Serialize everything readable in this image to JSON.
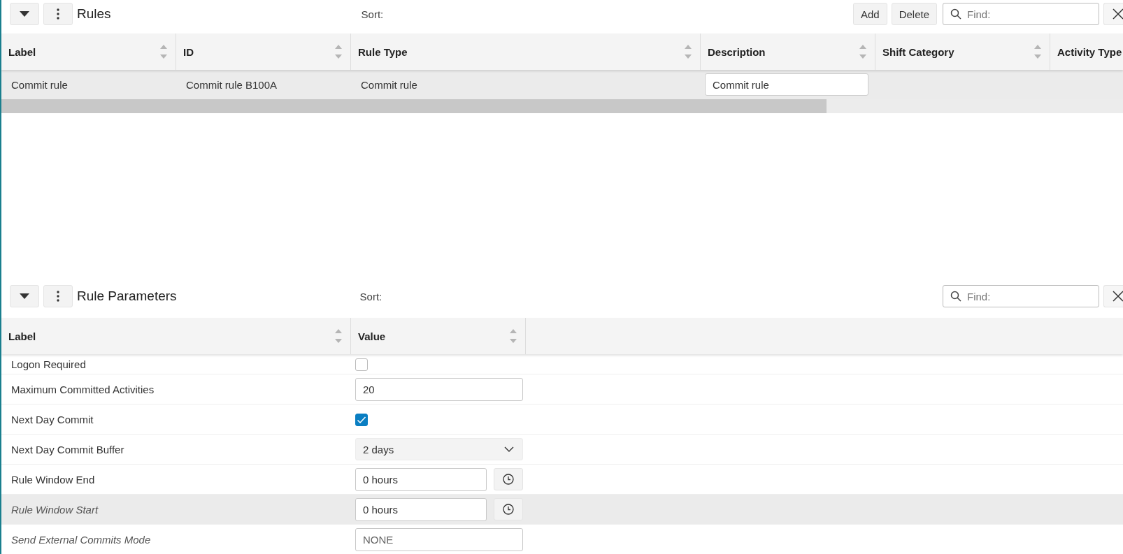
{
  "rules_panel": {
    "title": "Rules",
    "sort_label": "Sort:",
    "buttons": [
      "Add",
      "Delete"
    ],
    "search": {
      "placeholder": "Find:"
    },
    "columns": [
      {
        "label": "Label",
        "sortable": true
      },
      {
        "label": "ID",
        "sortable": true
      },
      {
        "label": "Rule Type",
        "sortable": true
      },
      {
        "label": "Description",
        "sortable": true
      },
      {
        "label": "Shift Category",
        "sortable": true
      },
      {
        "label": "Activity Type"
      }
    ],
    "rows": [
      {
        "selected": true,
        "cells": [
          {
            "kind": "text",
            "value": "Commit rule"
          },
          {
            "kind": "text",
            "value": "Commit rule B100A"
          },
          {
            "kind": "text",
            "value": "Commit rule"
          },
          {
            "kind": "input",
            "value": "Commit rule"
          },
          {
            "kind": "blank"
          },
          {
            "kind": "blank"
          }
        ]
      }
    ]
  },
  "parameters_panel": {
    "title": "Rule Parameters",
    "sort_label": "Sort:",
    "search": {
      "placeholder": "Find:"
    },
    "columns": [
      {
        "label": "Label",
        "sortable": true
      },
      {
        "label": "Value",
        "sortable": true
      }
    ],
    "rows": [
      {
        "label": "Logon Required",
        "inherited": false,
        "selected": false,
        "kind": "checkbox",
        "checked": false
      },
      {
        "label": "Maximum Committed Activities",
        "inherited": false,
        "selected": false,
        "kind": "text",
        "value": "20"
      },
      {
        "label": "Next Day Commit",
        "inherited": false,
        "selected": false,
        "kind": "checkbox",
        "checked": true
      },
      {
        "label": "Next Day Commit Buffer",
        "inherited": false,
        "selected": false,
        "kind": "dropdown",
        "value": "2 days"
      },
      {
        "label": "Rule Window End",
        "inherited": false,
        "selected": false,
        "kind": "time",
        "value": "0 hours"
      },
      {
        "label": "Rule Window Start",
        "inherited": true,
        "selected": true,
        "kind": "time",
        "value": "0 hours"
      },
      {
        "label": "Send External Commits Mode",
        "inherited": true,
        "selected": false,
        "kind": "text",
        "value": "NONE"
      }
    ]
  }
}
